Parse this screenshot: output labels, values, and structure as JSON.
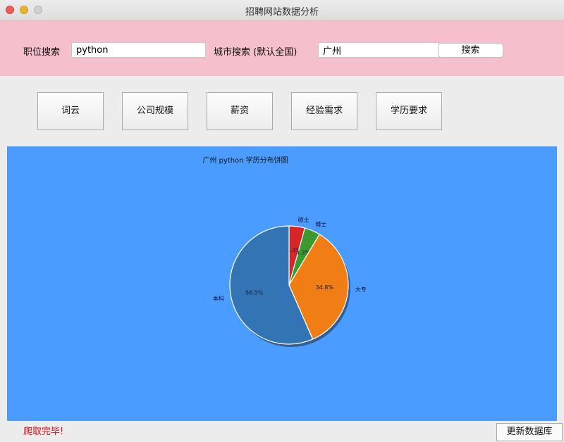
{
  "window": {
    "title": "招聘网站数据分析"
  },
  "search": {
    "job_label": "职位搜索",
    "job_value": "python",
    "city_label": "城市搜索 (默认全国)",
    "city_value": "广州",
    "search_button": "搜索"
  },
  "tabs": [
    {
      "label": "词云"
    },
    {
      "label": "公司规模"
    },
    {
      "label": "薪资"
    },
    {
      "label": "经验需求"
    },
    {
      "label": "学历要求"
    }
  ],
  "colors": {
    "panel": "#f5c0cc",
    "chart_bg": "#4a9dff",
    "status": "#e01010"
  },
  "chart_data": {
    "type": "pie",
    "title": "广州 python 学历分布饼图",
    "slices": [
      {
        "label": "硕士",
        "value": 4.3,
        "text": "4.3%",
        "color": "#d62728"
      },
      {
        "label": "博士",
        "value": 4.3,
        "text": "4.3%",
        "color": "#3a9a2c"
      },
      {
        "label": "大专",
        "value": 34.8,
        "text": "34.8%",
        "color": "#f07e14"
      },
      {
        "label": "本科",
        "value": 56.5,
        "text": "56.5%",
        "color": "#3274b4"
      }
    ],
    "shadow": true,
    "start_angle_deg": 90,
    "direction": "clockwise"
  },
  "status": {
    "text": "爬取完毕!"
  },
  "footer": {
    "update_button": "更新数据库"
  }
}
